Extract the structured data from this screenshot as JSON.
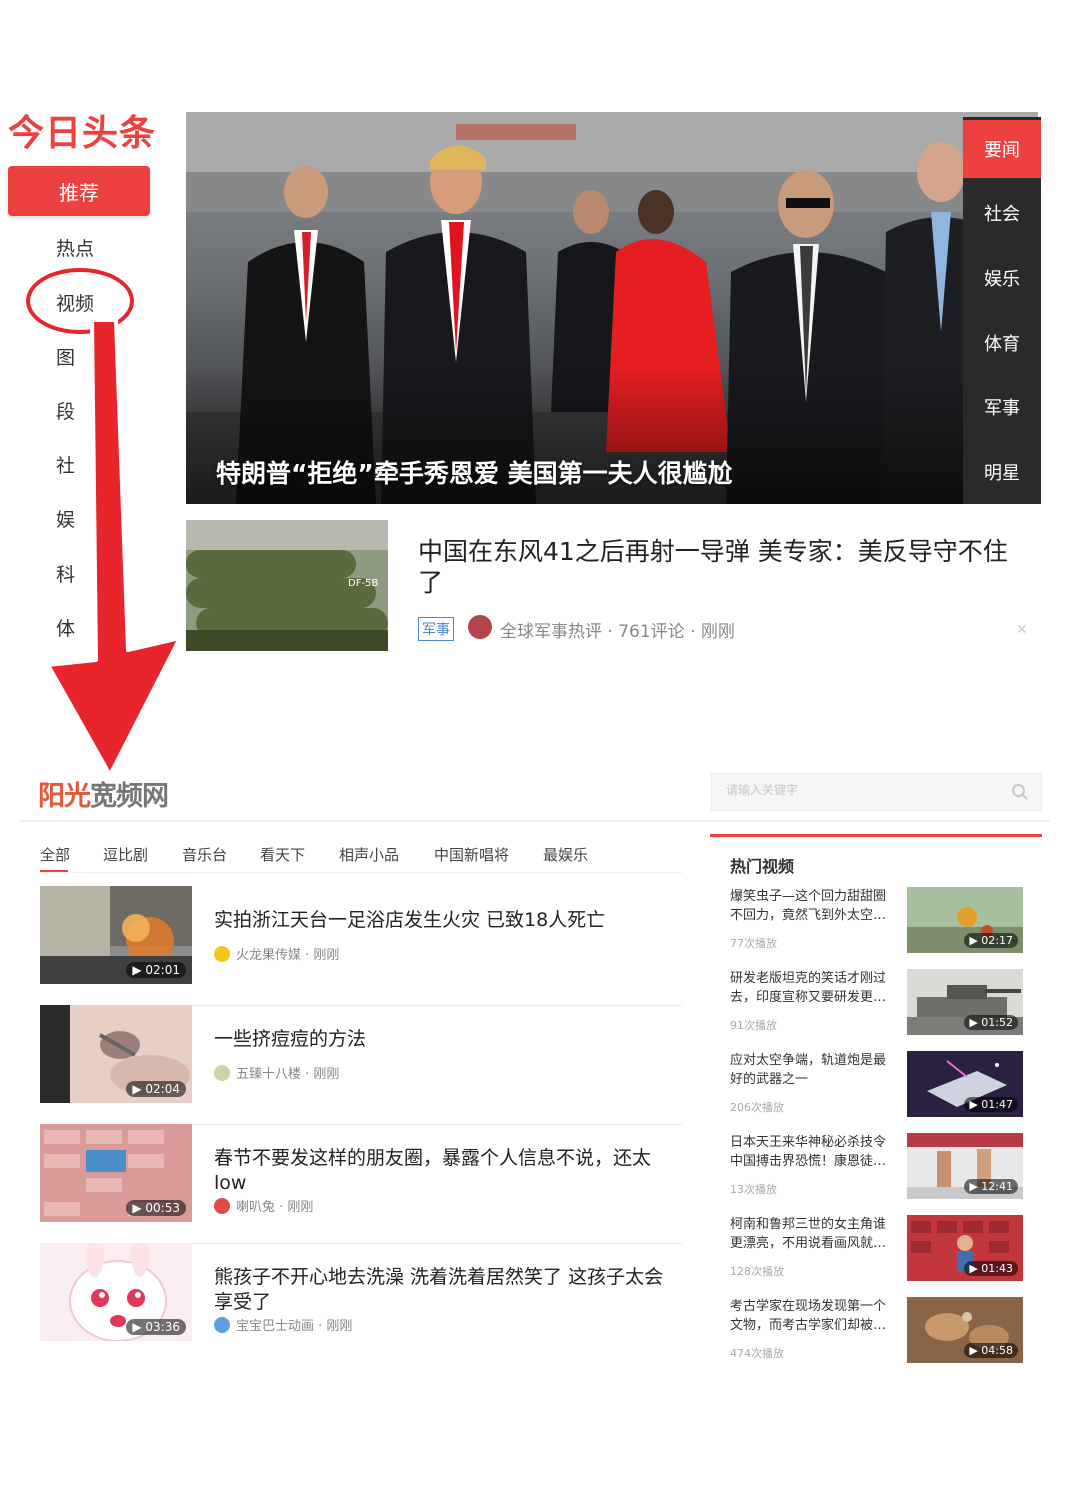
{
  "toutiao": {
    "logo": "今日头条",
    "nav": [
      "推荐",
      "热点",
      "视频",
      "图片",
      "段子",
      "社会",
      "娱乐",
      "科技",
      "体育"
    ],
    "nav_visible": [
      "推荐",
      "热点",
      "视频",
      "图",
      "段",
      "社",
      "娱",
      "科",
      "体"
    ],
    "hero_caption": "特朗普“拒绝”牵手秀恩爱 美国第一夫人很尴尬",
    "hero_nav": [
      "要闻",
      "社会",
      "娱乐",
      "体育",
      "军事",
      "明星"
    ],
    "news": {
      "title": "中国在东风41之后再射一导弹 美专家：美反导守不住了",
      "tag": "军事",
      "meta": "全球军事热评 · 761评论 · 刚刚",
      "close": "✕",
      "thumb_label": "DF-5B"
    }
  },
  "yangguang": {
    "logo_part1": "阳光",
    "logo_part2": "宽频网",
    "search_placeholder": "请输入关键字",
    "tabs": [
      "全部",
      "逗比剧",
      "音乐台",
      "看天下",
      "相声小品",
      "中国新唱将",
      "最娱乐"
    ],
    "videos": [
      {
        "title": "实拍浙江天台一足浴店发生火灾 已致18人死亡",
        "meta": "火龙果传媒 · 刚刚",
        "duration": "02:01"
      },
      {
        "title": "一些挤痘痘的方法",
        "meta": "五臻十八楼 · 刚刚",
        "duration": "02:04"
      },
      {
        "title": "春节不要发这样的朋友圈，暴露个人信息不说，还太low",
        "meta": "喇叭兔 · 刚刚",
        "duration": "00:53"
      },
      {
        "title": "熊孩子不开心地去洗澡 洗着洗着居然笑了 这孩子太会享受了",
        "meta": "宝宝巴士动画 · 刚刚",
        "duration": "03:36"
      }
    ],
    "hot": {
      "title": "热门视频",
      "items": [
        {
          "title": "爆笑虫子—这个回力甜甜圈不回力，竟然飞到外太空…",
          "plays": "77次播放",
          "duration": "02:17"
        },
        {
          "title": "研发老版坦克的笑话才刚过去，印度宣称又要研发更…",
          "plays": "91次播放",
          "duration": "01:52"
        },
        {
          "title": "应对太空争端，轨道炮是最好的武器之一",
          "plays": "206次播放",
          "duration": "01:47"
        },
        {
          "title": "日本天王来华神秘必杀技令中国搏击界恐慌！康恩徒…",
          "plays": "13次播放",
          "duration": "12:41"
        },
        {
          "title": "柯南和鲁邦三世的女主角谁更漂亮，不用说看画风就…",
          "plays": "128次播放",
          "duration": "01:43"
        },
        {
          "title": "考古学家在现场发现第一个文物，而考古学家们却被…",
          "plays": "474次播放",
          "duration": "04:58"
        }
      ]
    }
  }
}
